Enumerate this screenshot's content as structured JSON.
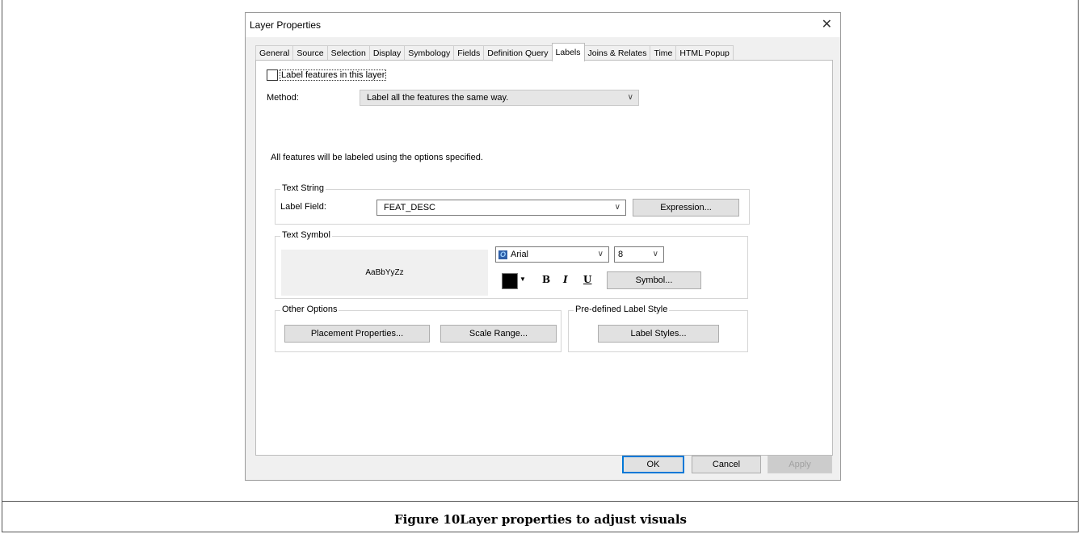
{
  "dialog": {
    "title": "Layer Properties",
    "close_glyph": "✕",
    "tabs": [
      "General",
      "Source",
      "Selection",
      "Display",
      "Symbology",
      "Fields",
      "Definition Query",
      "Labels",
      "Joins & Relates",
      "Time",
      "HTML Popup"
    ],
    "active_tab": "Labels"
  },
  "labels": {
    "checkbox_label": "Label features in this layer",
    "method_label": "Method:",
    "method_value": "Label all the features the same way.",
    "info_text": "All features will be labeled using the options specified.",
    "text_string": {
      "group_label": "Text String",
      "field_label": "Label Field:",
      "field_value": "FEAT_DESC",
      "expression_button": "Expression..."
    },
    "text_symbol": {
      "group_label": "Text Symbol",
      "preview": "AaBbYyZz",
      "font": "Arial",
      "font_icon_glyph": "O",
      "size": "8",
      "color": "#000000",
      "bold": "B",
      "italic": "I",
      "underline": "U",
      "symbol_button": "Symbol..."
    },
    "other_options": {
      "group_label": "Other Options",
      "placement_button": "Placement Properties...",
      "scale_button": "Scale Range..."
    },
    "predefined": {
      "group_label": "Pre-defined Label Style",
      "styles_button": "Label Styles..."
    }
  },
  "footer": {
    "ok": "OK",
    "cancel": "Cancel",
    "apply": "Apply"
  },
  "caption": "Figure 10Layer properties to adjust visuals",
  "chevron": "∨"
}
